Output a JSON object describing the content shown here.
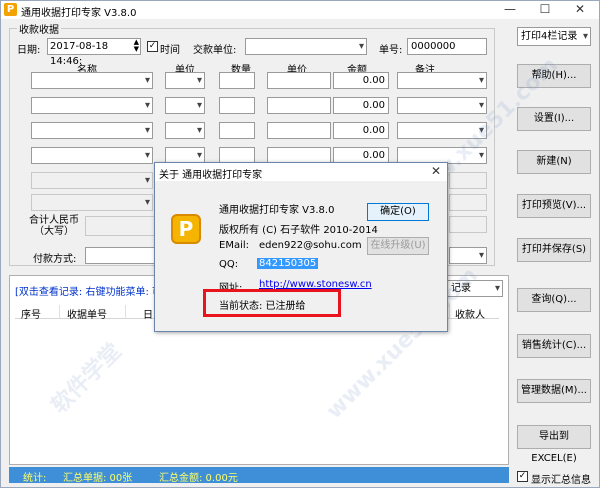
{
  "window": {
    "title": "通用收据打印专家 V3.8.0",
    "icon_letter": "P",
    "controls": [
      "—",
      "☐",
      "✕"
    ]
  },
  "receipt": {
    "group_label": "收款收据",
    "date_label": "日期:",
    "date_value": "2017-08-18 14:46:",
    "time_checkbox_label": "时间",
    "time_checked": true,
    "payer_label": "交款单位:",
    "number_label": "单号:",
    "number_value": "0000000",
    "columns": [
      "名称",
      "单位",
      "数量",
      "单价",
      "金额",
      "备注"
    ],
    "amounts": [
      "0.00",
      "0.00",
      "0.00",
      "0.00"
    ],
    "total_label_line1": "合计人民币",
    "total_label_line2": "（大写）",
    "payment_label": "付款方式:"
  },
  "right_buttons": {
    "print_mode": "打印4栏记录",
    "help": "帮助(H)...",
    "settings": "设置(I)...",
    "new": "新建(N)",
    "preview": "打印预览(V)...",
    "print_save": "打印并保存(S)",
    "query": "查询(Q)...",
    "sales_stats": "销售统计(C)...",
    "manage_data": "管理数据(M)...",
    "export_excel": "导出到EXCEL(E)"
  },
  "records": {
    "hint": "[双击查看记录: 右键功能菜单: 可打",
    "filter_value": "记录",
    "columns": [
      "序号",
      "收据单号",
      "日",
      "收款人"
    ]
  },
  "status": {
    "prefix": "统计:",
    "count_label": "汇总单据: 00张",
    "amount_label": "汇总金额: 0.00元",
    "show_summary_label": "显示汇总信息",
    "show_summary_checked": true
  },
  "about_dialog": {
    "title": "关于 通用收据打印专家",
    "product": "通用收据打印专家 V3.8.0",
    "copyright": "版权所有 (C) 石子软件 2010-2014",
    "email_label": "EMail:",
    "email_value": "eden922@sohu.com",
    "qq_label": "QQ:",
    "qq_value": "842150305",
    "site_label": "网址:",
    "site_value": "http://www.stonesw.cn",
    "status_label": "当前状态: 已注册给",
    "ok_button": "确定(O)",
    "upgrade_button": "在线升级(U)",
    "logo_letter": "P"
  },
  "colors": {
    "highlight_box": "#e8131d",
    "status_bar": "#3f8fd8",
    "status_text": "#ffff66",
    "link": "#0000ee",
    "selection": "#3399ff"
  },
  "watermark": [
    "软件学堂",
    "www.xue51.com"
  ]
}
